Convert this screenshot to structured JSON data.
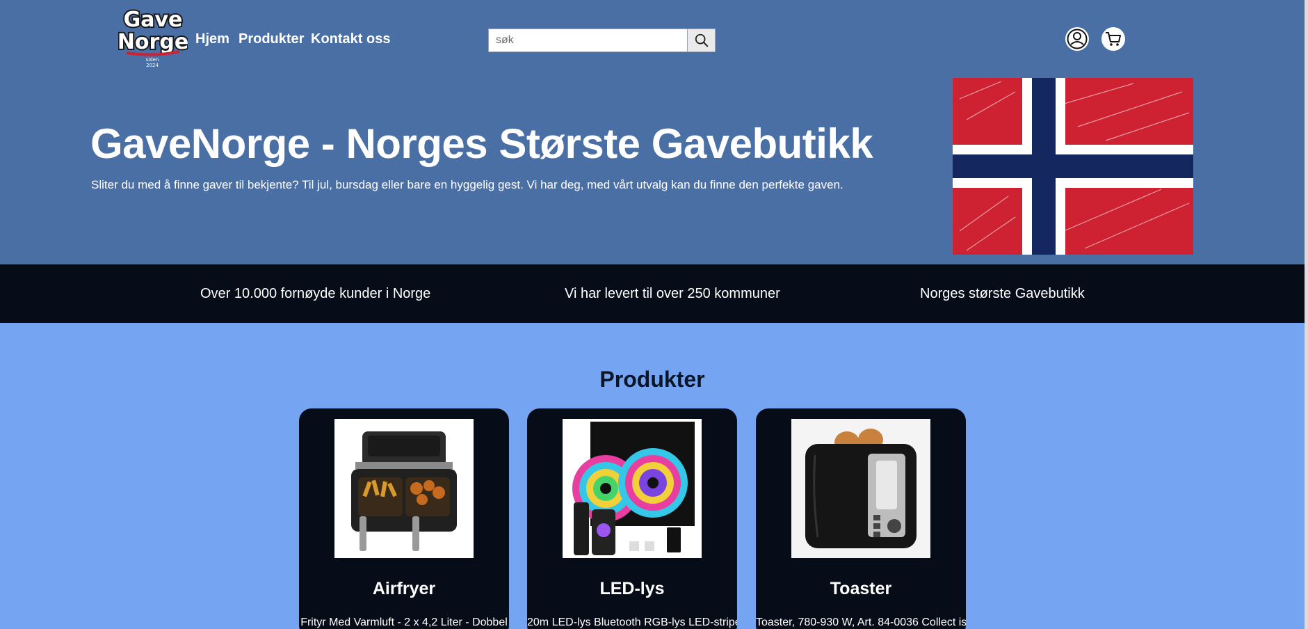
{
  "header": {
    "logo": {
      "line1": "Gave",
      "line2": "Norge",
      "since_label": "siden",
      "since_year": "2024"
    },
    "nav": [
      {
        "label": "Hjem"
      },
      {
        "label": "Produkter"
      },
      {
        "label": "Kontakt oss"
      }
    ],
    "search": {
      "placeholder": "søk",
      "icon": "search-icon"
    },
    "icons": {
      "account": "user-icon",
      "cart": "cart-icon"
    }
  },
  "hero": {
    "title": "GaveNorge - Norges Største Gavebutikk",
    "text": "Sliter du med å finne gaver til bekjente? Til jul, bursdag eller bare en hyggelig gest. Vi har deg, med vårt utvalg kan du finne den perfekte gaven.",
    "image": "norwegian-flag-sketch"
  },
  "stats": [
    {
      "text": "Over 10.000 fornøyde kunder i Norge"
    },
    {
      "text": "Vi har levert til over 250 kommuner"
    },
    {
      "text": "Norges største Gavebutikk"
    }
  ],
  "products": {
    "title": "Produkter",
    "items": [
      {
        "name": "Airfryer",
        "description": "Frityr Med Varmluft - 2 x 4,2 Liter - Dobbel",
        "image": "airfryer-image"
      },
      {
        "name": "LED-lys",
        "description": "20m LED-lys Bluetooth RGB-lys LED-stripe-",
        "image": "led-strip-image"
      },
      {
        "name": "Toaster",
        "description": "Toaster, 780-930 W, Art. 84-0036 Collect is",
        "image": "toaster-image"
      }
    ]
  },
  "colors": {
    "hero_bg": "#4a6fa5",
    "stats_bg": "#070d18",
    "page_bg": "#75a5f2",
    "card_bg": "#070d18",
    "flag_red": "#ce2232",
    "flag_blue": "#14275e"
  }
}
